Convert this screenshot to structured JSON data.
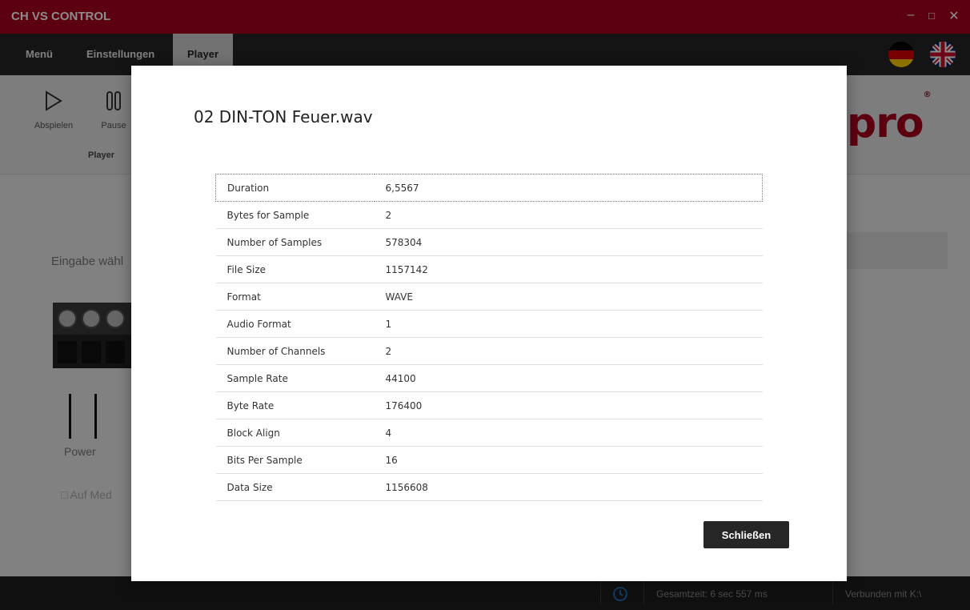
{
  "window": {
    "title": "CH VS CONTROL",
    "minimize_glyph": "‒",
    "maximize_glyph": "□",
    "close_glyph": "✕"
  },
  "menubar": {
    "tabs": [
      {
        "label": "Menü"
      },
      {
        "label": "Einstellungen"
      },
      {
        "label": "Player",
        "active": true
      }
    ],
    "flags": [
      "germany-flag-icon",
      "uk-flag-icon"
    ]
  },
  "ribbon": {
    "play_label": "Abspielen",
    "pause_label": "Pause",
    "group_label": "Player",
    "logo_text": "pro",
    "logo_reg": "®"
  },
  "background": {
    "input_label": "Eingabe wähl",
    "power_label": "Power",
    "media_label": "Auf Med"
  },
  "statusbar": {
    "total_time": "Gesamtzeit:  6 sec  557 ms",
    "connected": "Verbunden mit  K:\\"
  },
  "modal": {
    "title": "02 DIN-TON Feuer.wav",
    "rows": [
      {
        "key": "Duration",
        "value": "6,5567"
      },
      {
        "key": "Bytes for Sample",
        "value": "2"
      },
      {
        "key": "Number of Samples",
        "value": "578304"
      },
      {
        "key": "File Size",
        "value": "1157142"
      },
      {
        "key": "Format",
        "value": "WAVE"
      },
      {
        "key": "Audio Format",
        "value": "1"
      },
      {
        "key": "Number of Channels",
        "value": "2"
      },
      {
        "key": "Sample Rate",
        "value": "44100"
      },
      {
        "key": "Byte Rate",
        "value": "176400"
      },
      {
        "key": "Block Align",
        "value": "4"
      },
      {
        "key": "Bits Per Sample",
        "value": "16"
      },
      {
        "key": "Data Size",
        "value": "1156608"
      }
    ],
    "close_label": "Schließen"
  },
  "colors": {
    "accent": "#a8001c",
    "menubar": "#262626",
    "statusbar": "#1e1e1e"
  }
}
